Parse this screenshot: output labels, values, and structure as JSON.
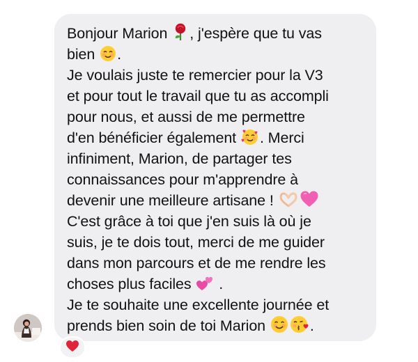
{
  "message": {
    "lines": [
      {
        "before": "Bonjour Marion ",
        "after": ", j'espère que tu vas"
      },
      {
        "before": "bien ",
        "after": "."
      },
      {
        "text": "Je voulais juste te remercier pour la V3"
      },
      {
        "text": "et pour tout le travail que tu as accompli"
      },
      {
        "text": "pour nous, et aussi de me permettre"
      },
      {
        "before": "d'en bénéficier également ",
        "after": ". Merci"
      },
      {
        "text": "infiniment, Marion, de partager tes"
      },
      {
        "text": "connaissances pour m'apprendre à"
      },
      {
        "before": "devenir une meilleure artisane ! ",
        "after": ""
      },
      {
        "text": "C'est grâce à toi que j'en suis là où je"
      },
      {
        "text": "suis,  je te dois tout, merci de me guider"
      },
      {
        "text": "dans mon parcours et de me rendre les"
      },
      {
        "before": "choses plus faciles ",
        "after": " ."
      },
      {
        "text": "Je te souhaite une excellente journée et"
      },
      {
        "before": "prends bien soin de toi Marion ",
        "after": "."
      }
    ],
    "emojis": {
      "rose": "rose-emoji",
      "smiling_blush": "smiling-face-emoji",
      "hearts_face": "smiling-face-with-hearts-emoji",
      "heart_hands": "heart-hands-emoji",
      "pink_heart": "pink-heart-emoji",
      "two_hearts": "two-hearts-emoji",
      "smile": "smiling-face-emoji",
      "kiss": "face-blowing-kiss-emoji"
    }
  },
  "reaction": {
    "icon": "red-heart-icon"
  },
  "colors": {
    "bubble": "#efeff1",
    "text": "#111111",
    "reaction_heart": "#e0243a"
  }
}
